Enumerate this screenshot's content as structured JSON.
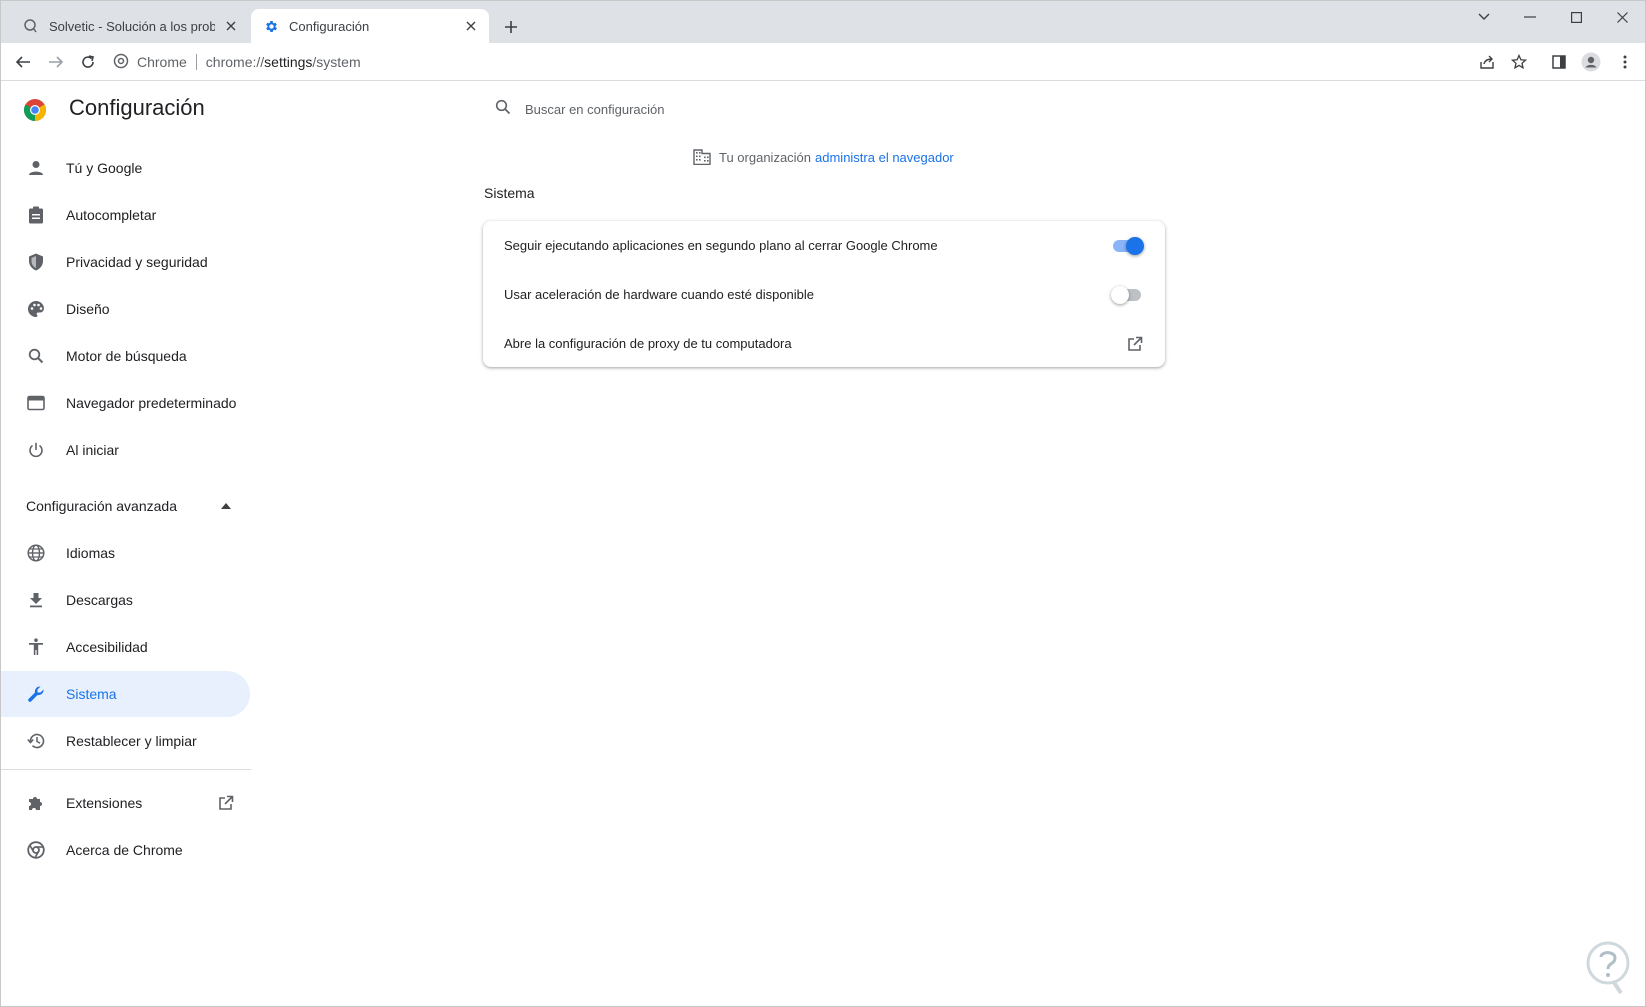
{
  "tabs": [
    {
      "title": "Solvetic - Solución a los problem",
      "active": false
    },
    {
      "title": "Configuración",
      "active": true
    }
  ],
  "toolbar": {
    "chip": "Chrome",
    "url_scheme": "chrome://",
    "url_host": "settings",
    "url_path": "/system"
  },
  "settings": {
    "title": "Configuración",
    "search_placeholder": "Buscar en configuración"
  },
  "sidebar": {
    "items": [
      {
        "label": "Tú y Google",
        "icon": "person-icon"
      },
      {
        "label": "Autocompletar",
        "icon": "clipboard-icon"
      },
      {
        "label": "Privacidad y seguridad",
        "icon": "shield-icon"
      },
      {
        "label": "Diseño",
        "icon": "palette-icon"
      },
      {
        "label": "Motor de búsqueda",
        "icon": "search-icon"
      },
      {
        "label": "Navegador predeterminado",
        "icon": "browser-icon"
      },
      {
        "label": "Al iniciar",
        "icon": "power-icon"
      }
    ],
    "advanced_label": "Configuración avanzada",
    "advanced_items": [
      {
        "label": "Idiomas",
        "icon": "globe-icon"
      },
      {
        "label": "Descargas",
        "icon": "download-icon"
      },
      {
        "label": "Accesibilidad",
        "icon": "accessibility-icon"
      },
      {
        "label": "Sistema",
        "icon": "wrench-icon",
        "selected": true
      },
      {
        "label": "Restablecer y limpiar",
        "icon": "restore-icon"
      }
    ],
    "extensions_label": "Extensiones",
    "about_label": "Acerca de Chrome"
  },
  "main": {
    "managed_text": "Tu organización",
    "managed_link": "administra el navegador",
    "section_title": "Sistema",
    "rows": [
      {
        "label": "Seguir ejecutando aplicaciones en segundo plano al cerrar Google Chrome",
        "toggle": true
      },
      {
        "label": "Usar aceleración de hardware cuando esté disponible",
        "toggle": false
      },
      {
        "label": "Abre la configuración de proxy de tu computadora",
        "external": true
      }
    ]
  },
  "colors": {
    "accent": "#1a73e8",
    "selected_bg": "#e8f0fe",
    "tabstrip_bg": "#dee1e6",
    "text": "#202124",
    "secondary_text": "#5f6368"
  }
}
